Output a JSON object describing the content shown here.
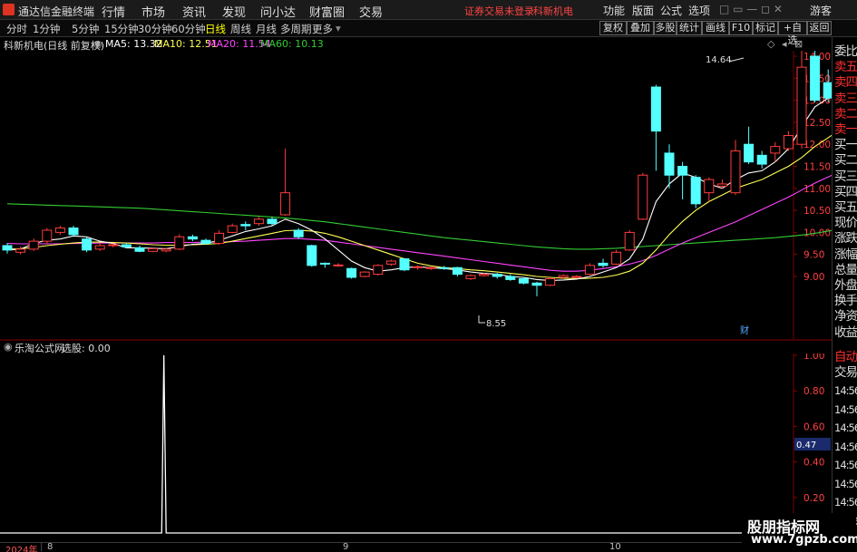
{
  "app": {
    "title": "通达信金融终端"
  },
  "menu": [
    "行情",
    "市场",
    "资讯",
    "发现",
    "问小达",
    "财富圈",
    "交易"
  ],
  "status": {
    "login": "证券交易未登录",
    "stock": "科新机电"
  },
  "right_menu": [
    "功能",
    "版面",
    "公式",
    "选项",
    "游客"
  ],
  "periods": [
    "分时",
    "1分钟",
    "5分钟",
    "15分钟",
    "30分钟",
    "60分钟",
    "日线",
    "周线",
    "月线",
    "多周期",
    "更多"
  ],
  "active_period": "日线",
  "toolbar_buttons": [
    "复权",
    "叠加",
    "多股",
    "统计",
    "画线",
    "F10",
    "标记",
    "+自选",
    "返回"
  ],
  "info": {
    "title": "科新机电(日线 前复权)",
    "ma5": "MA5: 13.32",
    "ma10": "MA10: 12.51",
    "ma20": "MA20: 11.54",
    "ma60": "MA60: 10.13"
  },
  "colors": {
    "up": "#ff3c3c",
    "down": "#54ffff",
    "ma5": "#ffffff",
    "ma10": "#ffff55",
    "ma20": "#ff44ff",
    "ma60": "#33cc33"
  },
  "price_axis": [
    "14.00",
    "13.50",
    "13.00",
    "12.50",
    "12.00",
    "11.50",
    "11.00",
    "10.50",
    "10.00",
    "9.50",
    "9.00"
  ],
  "annotations": {
    "high": "14.64",
    "low": "8.55",
    "cai": "财"
  },
  "candles": [
    {
      "o": 9.7,
      "c": 9.6,
      "h": 9.76,
      "l": 9.52
    },
    {
      "o": 9.55,
      "c": 9.62,
      "h": 9.68,
      "l": 9.5
    },
    {
      "o": 9.62,
      "c": 9.8,
      "h": 9.86,
      "l": 9.58
    },
    {
      "o": 9.8,
      "c": 10.05,
      "h": 10.1,
      "l": 9.74
    },
    {
      "o": 10.0,
      "c": 10.1,
      "h": 10.15,
      "l": 9.95
    },
    {
      "o": 10.1,
      "c": 9.95,
      "h": 10.15,
      "l": 9.9
    },
    {
      "o": 9.85,
      "c": 9.6,
      "h": 9.9,
      "l": 9.55
    },
    {
      "o": 9.62,
      "c": 9.7,
      "h": 9.75,
      "l": 9.58
    },
    {
      "o": 9.7,
      "c": 9.72,
      "h": 9.75,
      "l": 9.66
    },
    {
      "o": 9.72,
      "c": 9.67,
      "h": 9.76,
      "l": 9.64
    },
    {
      "o": 9.65,
      "c": 9.57,
      "h": 9.7,
      "l": 9.55
    },
    {
      "o": 9.57,
      "c": 9.63,
      "h": 9.66,
      "l": 9.55
    },
    {
      "o": 9.58,
      "c": 9.62,
      "h": 9.65,
      "l": 9.55
    },
    {
      "o": 9.62,
      "c": 9.9,
      "h": 9.96,
      "l": 9.6
    },
    {
      "o": 9.9,
      "c": 9.85,
      "h": 9.95,
      "l": 9.8
    },
    {
      "o": 9.82,
      "c": 9.75,
      "h": 9.86,
      "l": 9.72
    },
    {
      "o": 9.75,
      "c": 9.98,
      "h": 10.05,
      "l": 9.72
    },
    {
      "o": 10.0,
      "c": 10.15,
      "h": 10.2,
      "l": 9.98
    },
    {
      "o": 10.18,
      "c": 10.15,
      "h": 10.25,
      "l": 10.05
    },
    {
      "o": 10.2,
      "c": 10.3,
      "h": 10.35,
      "l": 10.15
    },
    {
      "o": 10.3,
      "c": 10.2,
      "h": 10.35,
      "l": 10.15
    },
    {
      "o": 10.4,
      "c": 10.9,
      "h": 11.9,
      "l": 10.38
    },
    {
      "o": 10.05,
      "c": 9.9,
      "h": 10.1,
      "l": 9.85
    },
    {
      "o": 9.7,
      "c": 9.25,
      "h": 9.72,
      "l": 9.22
    },
    {
      "o": 9.3,
      "c": 9.28,
      "h": 9.32,
      "l": 9.2
    },
    {
      "o": 9.25,
      "c": 9.26,
      "h": 9.3,
      "l": 9.22
    },
    {
      "o": 9.18,
      "c": 8.98,
      "h": 9.2,
      "l": 8.95
    },
    {
      "o": 9.0,
      "c": 9.1,
      "h": 9.12,
      "l": 8.98
    },
    {
      "o": 9.05,
      "c": 9.25,
      "h": 9.28,
      "l": 9.02
    },
    {
      "o": 9.28,
      "c": 9.35,
      "h": 9.38,
      "l": 9.24
    },
    {
      "o": 9.4,
      "c": 9.15,
      "h": 9.42,
      "l": 9.12
    },
    {
      "o": 9.2,
      "c": 9.22,
      "h": 9.25,
      "l": 9.15
    },
    {
      "o": 9.18,
      "c": 9.2,
      "h": 9.22,
      "l": 9.15
    },
    {
      "o": 9.2,
      "c": 9.18,
      "h": 9.24,
      "l": 9.15
    },
    {
      "o": 9.2,
      "c": 9.05,
      "h": 9.22,
      "l": 9.0
    },
    {
      "o": 8.95,
      "c": 9.02,
      "h": 9.05,
      "l": 8.92
    },
    {
      "o": 9.02,
      "c": 9.05,
      "h": 9.08,
      "l": 9.0
    },
    {
      "o": 9.05,
      "c": 9.0,
      "h": 9.08,
      "l": 8.95
    },
    {
      "o": 9.0,
      "c": 8.93,
      "h": 9.05,
      "l": 8.9
    },
    {
      "o": 8.95,
      "c": 8.85,
      "h": 8.98,
      "l": 8.82
    },
    {
      "o": 8.85,
      "c": 8.8,
      "h": 8.88,
      "l": 8.55
    },
    {
      "o": 8.8,
      "c": 8.95,
      "h": 8.98,
      "l": 8.78
    },
    {
      "o": 8.98,
      "c": 9.02,
      "h": 9.05,
      "l": 8.95
    },
    {
      "o": 9.0,
      "c": 9.0,
      "h": 9.03,
      "l": 8.97
    },
    {
      "o": 9.05,
      "c": 9.25,
      "h": 9.3,
      "l": 9.03
    },
    {
      "o": 9.3,
      "c": 9.25,
      "h": 9.4,
      "l": 9.2
    },
    {
      "o": 9.28,
      "c": 9.55,
      "h": 9.6,
      "l": 9.26
    },
    {
      "o": 9.6,
      "c": 10.0,
      "h": 10.05,
      "l": 9.58
    },
    {
      "o": 10.3,
      "c": 11.3,
      "h": 11.35,
      "l": 10.28
    },
    {
      "o": 13.3,
      "c": 12.3,
      "h": 13.35,
      "l": 11.4
    },
    {
      "o": 11.8,
      "c": 11.3,
      "h": 12.0,
      "l": 11.0
    },
    {
      "o": 11.5,
      "c": 11.3,
      "h": 11.6,
      "l": 10.75
    },
    {
      "o": 11.25,
      "c": 10.65,
      "h": 11.3,
      "l": 10.55
    },
    {
      "o": 10.9,
      "c": 11.2,
      "h": 11.25,
      "l": 10.7
    },
    {
      "o": 11.05,
      "c": 11.1,
      "h": 11.2,
      "l": 11.0
    },
    {
      "o": 10.9,
      "c": 11.85,
      "h": 12.1,
      "l": 10.85
    },
    {
      "o": 12.0,
      "c": 11.6,
      "h": 12.4,
      "l": 11.55
    },
    {
      "o": 11.75,
      "c": 11.55,
      "h": 11.85,
      "l": 11.45
    },
    {
      "o": 11.8,
      "c": 11.95,
      "h": 12.05,
      "l": 11.6
    },
    {
      "o": 11.9,
      "c": 12.2,
      "h": 12.3,
      "l": 11.85
    },
    {
      "o": 12.0,
      "c": 13.75,
      "h": 14.3,
      "l": 11.9
    },
    {
      "o": 14.0,
      "c": 13.0,
      "h": 14.64,
      "l": 12.95
    },
    {
      "o": 13.4,
      "c": 13.05,
      "h": 13.7,
      "l": 12.95
    },
    {
      "o": 12.8,
      "c": 12.85,
      "h": 12.95,
      "l": 12.7
    },
    {
      "o": 12.9,
      "c": 13.15,
      "h": 13.2,
      "l": 12.75
    }
  ],
  "moving_averages": {
    "ma5": [
      9.6,
      9.62,
      9.75,
      9.82,
      9.85,
      9.92,
      9.9,
      9.8,
      9.75,
      9.65,
      9.65,
      9.64,
      9.63,
      9.68,
      9.73,
      9.75,
      9.82,
      9.92,
      10.02,
      10.08,
      10.15,
      10.3,
      10.2,
      10.05,
      9.85,
      9.6,
      9.35,
      9.2,
      9.12,
      9.15,
      9.2,
      9.22,
      9.2,
      9.18,
      9.15,
      9.1,
      9.07,
      9.05,
      9.0,
      8.98,
      8.93,
      8.91,
      8.92,
      8.94,
      9.0,
      9.1,
      9.2,
      9.4,
      9.85,
      10.7,
      11.1,
      11.35,
      11.25,
      11.1,
      11.0,
      11.2,
      11.35,
      11.4,
      11.6,
      11.9,
      12.4,
      12.85,
      13.05,
      13.1,
      13.3
    ],
    "ma10": [
      9.62,
      9.63,
      9.66,
      9.7,
      9.73,
      9.76,
      9.78,
      9.78,
      9.77,
      9.76,
      9.74,
      9.72,
      9.71,
      9.71,
      9.72,
      9.73,
      9.75,
      9.8,
      9.86,
      9.92,
      9.98,
      10.04,
      10.05,
      10.03,
      9.98,
      9.9,
      9.8,
      9.7,
      9.6,
      9.5,
      9.4,
      9.3,
      9.24,
      9.2,
      9.18,
      9.15,
      9.13,
      9.1,
      9.07,
      9.04,
      9.0,
      8.98,
      8.96,
      8.95,
      8.96,
      8.98,
      9.03,
      9.12,
      9.3,
      9.6,
      9.95,
      10.25,
      10.5,
      10.7,
      10.85,
      11.0,
      11.1,
      11.2,
      11.35,
      11.5,
      11.7,
      11.95,
      12.15,
      12.35,
      12.5
    ],
    "ma20": [
      9.75,
      9.74,
      9.74,
      9.74,
      9.74,
      9.75,
      9.75,
      9.76,
      9.76,
      9.76,
      9.76,
      9.76,
      9.77,
      9.77,
      9.77,
      9.78,
      9.78,
      9.79,
      9.8,
      9.82,
      9.84,
      9.86,
      9.86,
      9.84,
      9.82,
      9.78,
      9.74,
      9.7,
      9.66,
      9.62,
      9.58,
      9.54,
      9.5,
      9.46,
      9.42,
      9.38,
      9.34,
      9.3,
      9.26,
      9.22,
      9.18,
      9.14,
      9.12,
      9.12,
      9.14,
      9.18,
      9.22,
      9.28,
      9.36,
      9.48,
      9.62,
      9.76,
      9.88,
      10.0,
      10.12,
      10.24,
      10.38,
      10.52,
      10.66,
      10.8,
      10.96,
      11.12,
      11.26,
      11.4,
      11.54
    ],
    "ma60": [
      10.65,
      10.64,
      10.63,
      10.62,
      10.61,
      10.6,
      10.59,
      10.58,
      10.57,
      10.56,
      10.55,
      10.53,
      10.51,
      10.49,
      10.47,
      10.45,
      10.43,
      10.41,
      10.39,
      10.37,
      10.35,
      10.33,
      10.3,
      10.27,
      10.24,
      10.2,
      10.16,
      10.12,
      10.08,
      10.04,
      10.0,
      9.96,
      9.92,
      9.88,
      9.85,
      9.82,
      9.79,
      9.76,
      9.73,
      9.7,
      9.67,
      9.65,
      9.63,
      9.62,
      9.62,
      9.63,
      9.64,
      9.66,
      9.68,
      9.7,
      9.72,
      9.74,
      9.76,
      9.78,
      9.8,
      9.82,
      9.84,
      9.86,
      9.88,
      9.91,
      9.94,
      9.98,
      10.03,
      10.08,
      10.13
    ]
  },
  "indicator": {
    "title": "乐淘公式网",
    "value": "选股: 0.00",
    "axis": [
      "1.00",
      "0.80",
      "0.60",
      "0.40",
      "0.20"
    ],
    "current_value": "0.47",
    "signal": [
      0,
      0,
      0,
      0,
      0,
      0,
      0,
      0,
      0,
      0,
      0,
      0,
      0,
      0,
      0,
      0,
      0,
      0,
      0,
      0,
      0,
      0,
      0,
      0,
      0,
      0,
      0,
      0,
      0,
      0,
      0,
      0,
      0,
      0,
      0,
      0,
      0,
      0,
      0,
      0,
      0,
      0,
      0,
      0,
      0,
      0,
      0,
      0,
      0,
      0,
      0,
      0,
      0,
      0,
      0,
      0,
      0,
      0,
      0,
      0,
      0,
      0,
      0,
      0,
      0,
      0,
      0,
      0,
      0,
      0,
      0,
      0,
      0,
      1,
      0,
      0,
      0,
      0,
      0,
      0,
      0,
      0,
      0,
      0,
      0,
      0,
      0,
      0,
      0,
      0,
      0,
      0,
      0,
      0,
      0,
      0,
      0,
      0,
      0,
      0,
      0,
      0,
      0,
      0,
      0,
      0,
      0,
      0,
      0,
      0,
      0,
      0,
      0,
      0,
      0,
      0,
      0,
      0,
      0,
      0,
      0,
      0,
      0,
      0,
      0,
      0,
      0,
      0,
      0,
      0,
      0,
      0,
      0,
      0,
      0,
      0,
      0,
      0,
      0,
      0,
      0,
      0,
      0,
      0,
      0,
      0,
      0,
      0,
      0,
      0,
      0,
      0,
      0,
      0,
      0,
      0,
      0,
      0,
      0,
      0,
      0,
      0,
      0,
      0,
      0,
      0,
      0,
      0,
      0,
      0,
      0,
      0,
      0,
      0,
      0,
      0,
      0,
      0,
      0,
      0,
      0,
      0,
      0,
      0,
      0,
      0,
      0,
      0,
      0,
      0,
      0,
      0,
      0,
      0,
      0,
      0,
      0,
      0,
      0,
      0,
      0,
      0,
      0,
      0,
      0,
      0,
      0,
      0,
      0,
      0,
      0,
      0,
      0,
      0,
      0,
      0,
      0,
      0,
      0,
      0,
      0,
      0,
      0,
      0,
      0,
      0,
      0,
      0,
      0,
      0,
      0,
      0,
      0,
      0,
      0,
      0,
      0,
      0,
      0,
      0,
      0,
      0,
      0,
      0,
      0,
      0,
      0,
      0,
      0,
      0,
      0,
      0,
      0,
      0,
      0,
      0,
      0,
      0,
      0,
      0,
      0,
      0,
      0,
      0,
      0,
      0,
      0,
      0,
      0,
      0,
      0,
      0,
      0,
      0,
      0,
      0,
      0,
      0,
      0,
      0,
      0,
      0,
      0,
      0,
      0,
      0,
      0,
      0,
      0,
      0,
      0,
      0,
      0,
      0,
      0,
      0,
      0,
      0,
      0,
      0,
      0,
      0,
      0,
      0,
      0,
      0,
      0,
      0,
      0,
      0,
      0,
      0,
      0,
      0,
      0,
      0,
      0,
      0,
      0,
      0,
      0,
      0,
      0,
      0,
      0,
      0,
      0,
      0,
      0,
      0,
      0,
      0,
      0,
      0,
      0,
      0,
      0,
      0,
      0,
      0,
      0,
      0,
      0,
      0,
      0,
      0,
      0,
      0,
      0,
      0,
      0,
      0,
      0,
      0
    ]
  },
  "side_panel": {
    "quote_items": [
      "委比",
      "卖五",
      "卖四",
      "卖三",
      "卖二",
      "卖一",
      "买一",
      "买二",
      "买三",
      "买四",
      "买五",
      "现价",
      "涨跌",
      "涨幅",
      "总量",
      "外盘",
      "换手",
      "净资",
      "收益"
    ],
    "trade_items": [
      "自动",
      "交易"
    ],
    "times": [
      "14:56",
      "14:56",
      "14:56",
      "14:56",
      "14:56",
      "14:56",
      "14:56",
      "14:56"
    ]
  },
  "xaxis": [
    "2024年",
    "8",
    "9",
    "10"
  ],
  "watermark": {
    "line1": "股朋指标网",
    "line2": "www.7gpzb.com"
  }
}
